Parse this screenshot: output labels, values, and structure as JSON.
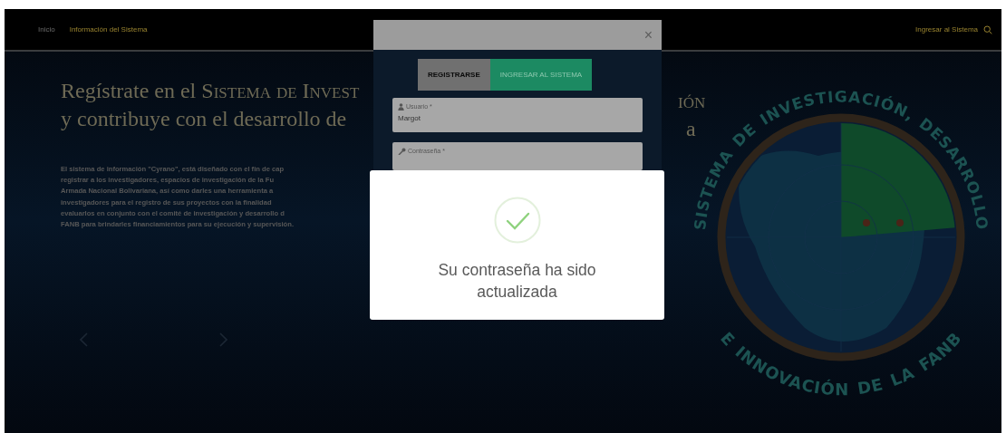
{
  "nav": {
    "links": [
      {
        "label": "Inicio",
        "selected": false
      },
      {
        "label": "Información del Sistema",
        "selected": true
      }
    ],
    "login_link": "Ingresar al Sistema"
  },
  "hero": {
    "heading_lines": [
      {
        "text": "Regístrate en el ",
        "caps": "Sistema de Invest",
        "tail": "ión"
      },
      {
        "text": "y contribuye con el desarrollo de ",
        "tail": "a"
      }
    ],
    "paragraph_lines": [
      "El sistema de información \"Cyrano\", está diseñado con el fin de cap",
      "registrar a los investigadores, espacios de investigación de la Fu",
      "Armada Nacional Bolivariana, así como darles una herramienta a",
      "investigadores para el registro de sus proyectos con la finalidad",
      "evaluarlos en conjunto con el comité de investigación y desarrollo d",
      "FANB para brindarles financiamientos para su ejecución y supervisión."
    ]
  },
  "emblem": {
    "top_words": [
      "SISTEMA",
      "DE",
      "INVESTIGACIÓN,",
      "DESARROLLO"
    ],
    "bottom_words": [
      "E",
      "INNOVACIÓN",
      "DE",
      "LA",
      "FANB"
    ]
  },
  "login_modal": {
    "close": "×",
    "tabs": [
      {
        "label": "REGISTRARSE",
        "selected": false
      },
      {
        "label": "INGRESAR AL SISTEMA",
        "selected": true
      }
    ],
    "fields": [
      {
        "kind": "user",
        "label": "Usuario *",
        "value": "Margot"
      },
      {
        "kind": "password",
        "label": "Contraseña *"
      }
    ]
  },
  "alert": {
    "kind": "success",
    "message": "Su contraseña ha sido actualizada"
  }
}
